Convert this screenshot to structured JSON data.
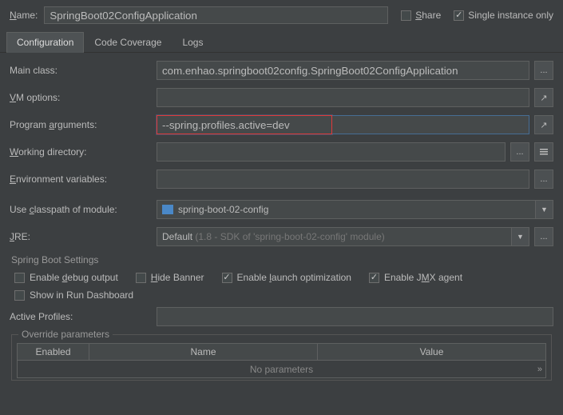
{
  "top": {
    "name_label": "Name:",
    "name_value": "SpringBoot02ConfigApplication",
    "share_label": "Share",
    "single_instance_label": "Single instance only",
    "single_instance_checked": true
  },
  "tabs": [
    "Configuration",
    "Code Coverage",
    "Logs"
  ],
  "active_tab": 0,
  "config": {
    "main_class": {
      "label": "Main class:",
      "value": "com.enhao.springboot02config.SpringBoot02ConfigApplication"
    },
    "vm_options": {
      "label": "VM options:",
      "value": ""
    },
    "program_args": {
      "label": "Program arguments:",
      "value": "--spring.profiles.active=dev"
    },
    "working_dir": {
      "label": "Working directory:",
      "value": ""
    },
    "env_vars": {
      "label": "Environment variables:",
      "value": ""
    },
    "classpath": {
      "label": "Use classpath of module:",
      "value": "spring-boot-02-config"
    },
    "jre": {
      "label": "JRE:",
      "value_prefix": "Default",
      "value_suffix": "(1.8 - SDK of 'spring-boot-02-config' module)"
    }
  },
  "spring": {
    "title": "Spring Boot Settings",
    "debug": "Enable debug output",
    "hide_banner": "Hide Banner",
    "launch_opt": "Enable launch optimization",
    "jmx": "Enable JMX agent",
    "dashboard": "Show in Run Dashboard",
    "active_profiles_label": "Active Profiles:",
    "active_profiles_value": ""
  },
  "override": {
    "title": "Override parameters",
    "col_enabled": "Enabled",
    "col_name": "Name",
    "col_value": "Value",
    "empty": "No parameters"
  },
  "underlines": {
    "name": "N",
    "share": "S",
    "vm": "V",
    "prog": "a",
    "work": "W",
    "env": "E",
    "class": "c",
    "jre": "J",
    "debug": "d",
    "hide": "H",
    "launch": "l",
    "jmx": "M"
  }
}
